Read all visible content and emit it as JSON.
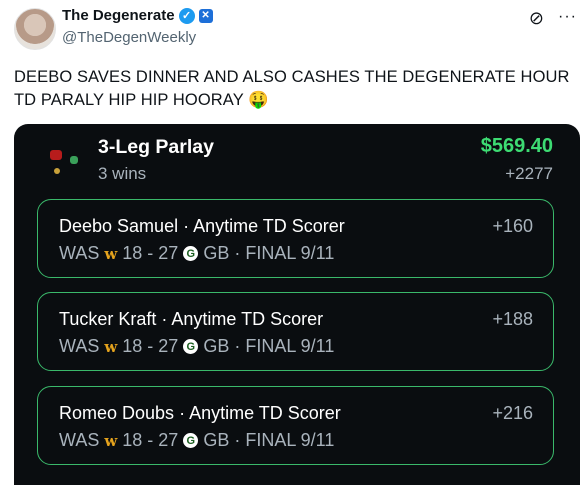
{
  "tweet": {
    "author_name": "The Degenerate",
    "handle": "@TheDegenWeekly",
    "text": "DEEBO SAVES DINNER AND ALSO CASHES THE DEGENERATE HOUR TD PARALY HIP HIP HOORAY 🤑"
  },
  "icons": {
    "verified": "verified-badge-icon",
    "affiliate": "affiliate-badge-icon",
    "grok": "grok-icon",
    "more": "more-icon"
  },
  "card": {
    "title": "3-Leg Parlay",
    "wins": "3 wins",
    "payout": "$569.40",
    "odds": "+2277",
    "colors": {
      "payout": "#3ddc73",
      "leg_border": "#3ab86a",
      "background": "#0a0d10"
    },
    "legs": [
      {
        "player": "Deebo Samuel",
        "market": "Anytime TD Scorer",
        "odds": "+160",
        "away": "WAS",
        "score": "18 - 27",
        "home": "GB",
        "status": "FINAL 9/11"
      },
      {
        "player": "Tucker Kraft",
        "market": "Anytime TD Scorer",
        "odds": "+188",
        "away": "WAS",
        "score": "18 - 27",
        "home": "GB",
        "status": "FINAL 9/11"
      },
      {
        "player": "Romeo Doubs",
        "market": "Anytime TD Scorer",
        "odds": "+216",
        "away": "WAS",
        "score": "18 - 27",
        "home": "GB",
        "status": "FINAL 9/11"
      }
    ]
  }
}
